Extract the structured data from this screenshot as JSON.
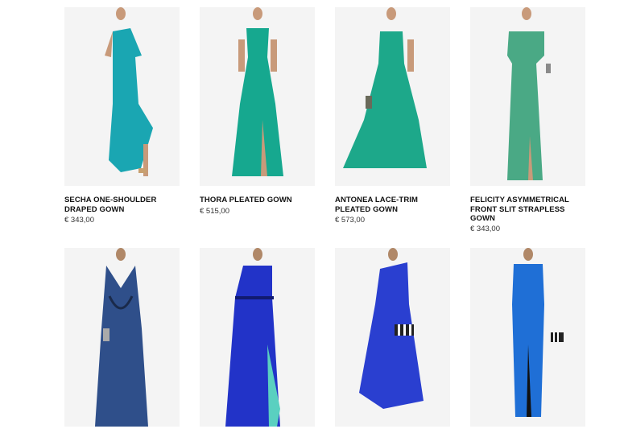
{
  "products": [
    {
      "name_lines": [
        "SECHA ONE-SHOULDER",
        "DRAPED GOWN"
      ],
      "price": "€ 343,00",
      "color": "#1aa6b2",
      "image_icon": "dress-photo"
    },
    {
      "name_lines": [
        "THORA PLEATED GOWN"
      ],
      "price": "€ 515,00",
      "color": "#16a88f",
      "image_icon": "dress-photo"
    },
    {
      "name_lines": [
        "ANTONEA LACE-TRIM",
        "PLEATED GOWN"
      ],
      "price": "€ 573,00",
      "color": "#1da88a",
      "image_icon": "dress-photo"
    },
    {
      "name_lines": [
        "FELICITY ASYMMETRICAL",
        "FRONT SLIT STRAPLESS",
        "GOWN"
      ],
      "price": "€ 343,00",
      "color": "#4aa985",
      "image_icon": "dress-photo"
    },
    {
      "name_lines": [],
      "price": "",
      "color": "#2f4f8a",
      "image_icon": "dress-photo"
    },
    {
      "name_lines": [],
      "price": "",
      "color": "#2233c8",
      "image_icon": "dress-photo"
    },
    {
      "name_lines": [],
      "price": "",
      "color": "#2a3fd0",
      "image_icon": "dress-photo"
    },
    {
      "name_lines": [],
      "price": "",
      "color": "#1f6fd6",
      "image_icon": "dress-photo"
    }
  ]
}
